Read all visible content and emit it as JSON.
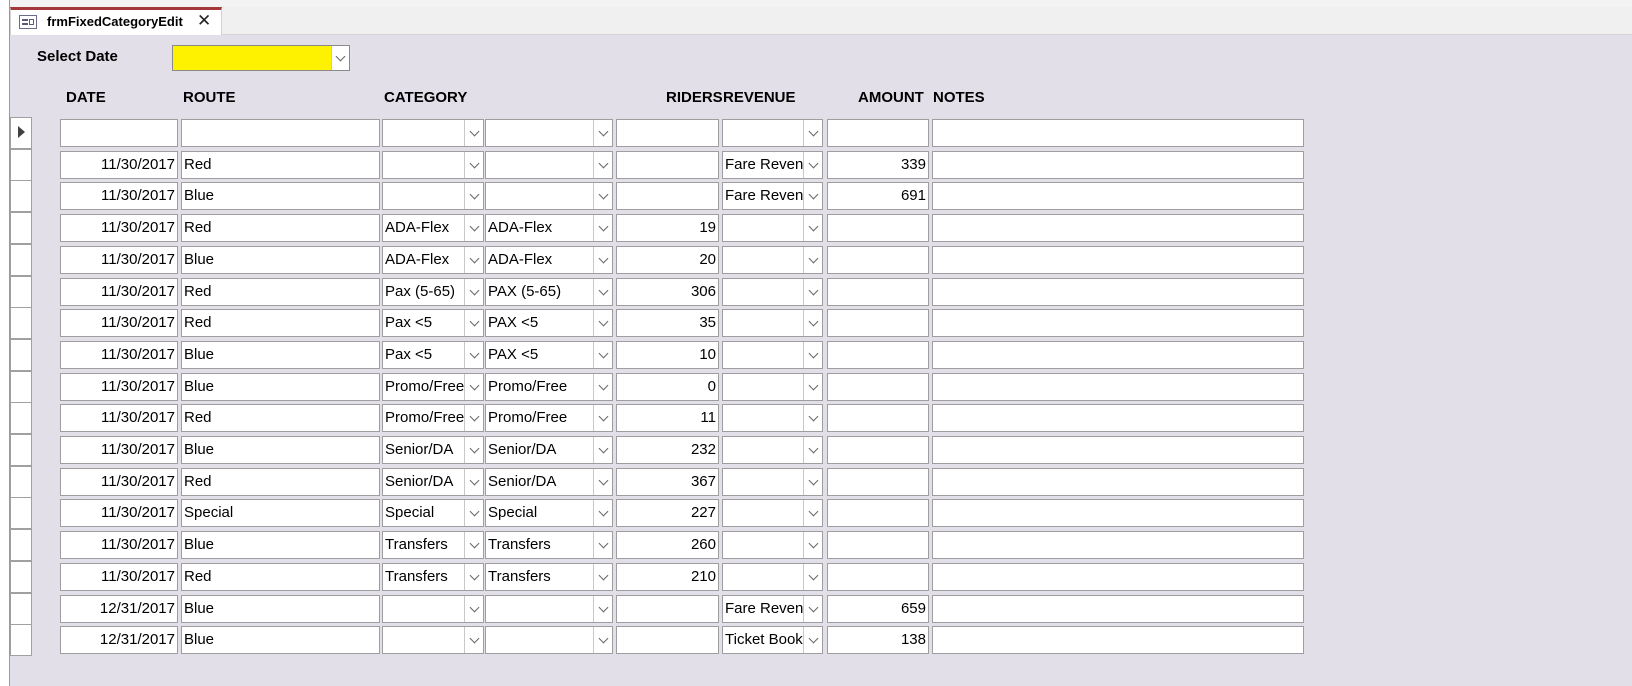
{
  "tab": {
    "title": "frmFixedCategoryEdit",
    "icon": "form-icon",
    "close_icon": "close-icon"
  },
  "filter": {
    "label": "Select Date",
    "value": ""
  },
  "headers": {
    "date": "DATE",
    "route": "ROUTE",
    "category": "CATEGORY",
    "riders": "RIDERS",
    "revenue": "REVENUE",
    "amount": "AMOUNT",
    "notes": "NOTES"
  },
  "colors": {
    "form_bg": "#e2dfe9",
    "date_highlight": "#fff200",
    "tab_accent": "#a4373a"
  },
  "rows": [
    {
      "date": "",
      "route": "",
      "category": "",
      "category2": "",
      "riders": "",
      "revenue": "",
      "amount": "",
      "notes": ""
    },
    {
      "date": "11/30/2017",
      "route": "Red",
      "category": "",
      "category2": "",
      "riders": "",
      "revenue": "Fare Revenue",
      "amount": "339",
      "notes": ""
    },
    {
      "date": "11/30/2017",
      "route": "Blue",
      "category": "",
      "category2": "",
      "riders": "",
      "revenue": "Fare Revenue",
      "amount": "691",
      "notes": ""
    },
    {
      "date": "11/30/2017",
      "route": "Red",
      "category": "ADA-Flex",
      "category2": "ADA-Flex",
      "riders": "19",
      "revenue": "",
      "amount": "",
      "notes": ""
    },
    {
      "date": "11/30/2017",
      "route": "Blue",
      "category": "ADA-Flex",
      "category2": "ADA-Flex",
      "riders": "20",
      "revenue": "",
      "amount": "",
      "notes": ""
    },
    {
      "date": "11/30/2017",
      "route": "Red",
      "category": "Pax (5-65)",
      "category2": "PAX (5-65)",
      "riders": "306",
      "revenue": "",
      "amount": "",
      "notes": ""
    },
    {
      "date": "11/30/2017",
      "route": "Red",
      "category": "Pax <5",
      "category2": "PAX <5",
      "riders": "35",
      "revenue": "",
      "amount": "",
      "notes": ""
    },
    {
      "date": "11/30/2017",
      "route": "Blue",
      "category": "Pax <5",
      "category2": "PAX <5",
      "riders": "10",
      "revenue": "",
      "amount": "",
      "notes": ""
    },
    {
      "date": "11/30/2017",
      "route": "Blue",
      "category": "Promo/Free",
      "category2": "Promo/Free",
      "riders": "0",
      "revenue": "",
      "amount": "",
      "notes": ""
    },
    {
      "date": "11/30/2017",
      "route": "Red",
      "category": "Promo/Free",
      "category2": "Promo/Free",
      "riders": "11",
      "revenue": "",
      "amount": "",
      "notes": ""
    },
    {
      "date": "11/30/2017",
      "route": "Blue",
      "category": "Senior/DA",
      "category2": "Senior/DA",
      "riders": "232",
      "revenue": "",
      "amount": "",
      "notes": ""
    },
    {
      "date": "11/30/2017",
      "route": "Red",
      "category": "Senior/DA",
      "category2": "Senior/DA",
      "riders": "367",
      "revenue": "",
      "amount": "",
      "notes": ""
    },
    {
      "date": "11/30/2017",
      "route": "Special",
      "category": "Special",
      "category2": "Special",
      "riders": "227",
      "revenue": "",
      "amount": "",
      "notes": ""
    },
    {
      "date": "11/30/2017",
      "route": "Blue",
      "category": "Transfers",
      "category2": "Transfers",
      "riders": "260",
      "revenue": "",
      "amount": "",
      "notes": ""
    },
    {
      "date": "11/30/2017",
      "route": "Red",
      "category": "Transfers",
      "category2": "Transfers",
      "riders": "210",
      "revenue": "",
      "amount": "",
      "notes": ""
    },
    {
      "date": "12/31/2017",
      "route": "Blue",
      "category": "",
      "category2": "",
      "riders": "",
      "revenue": "Fare Revenue",
      "amount": "659",
      "notes": ""
    },
    {
      "date": "12/31/2017",
      "route": "Blue",
      "category": "",
      "category2": "",
      "riders": "",
      "revenue": "Ticket Books",
      "amount": "138",
      "notes": ""
    }
  ]
}
